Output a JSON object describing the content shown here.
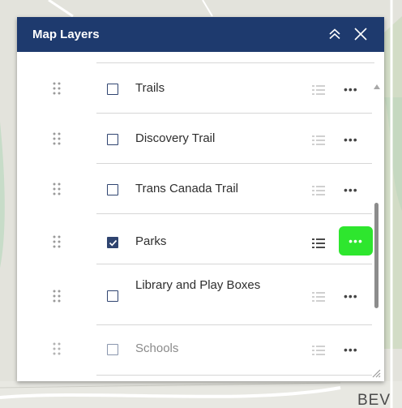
{
  "panel": {
    "title": "Map Layers",
    "collapse_icon": "double-chevron-up-icon",
    "close_icon": "close-icon"
  },
  "map": {
    "partial_label": "BEV"
  },
  "layers": [
    {
      "label": "Trails",
      "checked": false,
      "muted": false
    },
    {
      "label": "Discovery Trail",
      "checked": false,
      "muted": false
    },
    {
      "label": "Trans Canada Trail",
      "checked": false,
      "muted": false
    },
    {
      "label": "Parks",
      "checked": true,
      "muted": false
    },
    {
      "label": "Library and Play Boxes",
      "checked": false,
      "muted": false
    },
    {
      "label": "Schools",
      "checked": false,
      "muted": true
    }
  ],
  "colors": {
    "header_bg": "#1e3a6e",
    "checkbox": "#2f4470",
    "highlight": "#2ee62e"
  }
}
